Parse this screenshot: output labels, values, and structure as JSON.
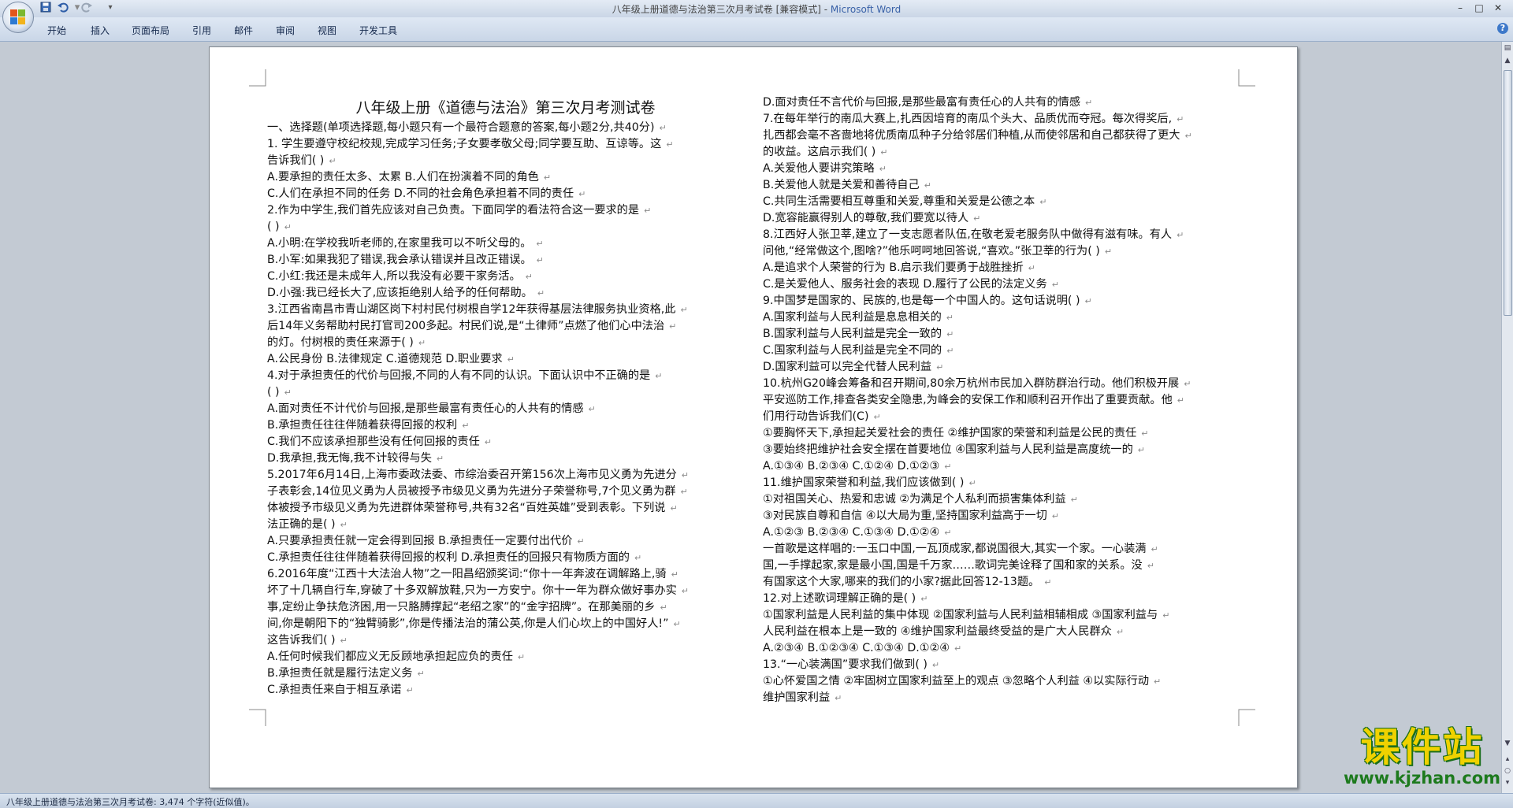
{
  "window": {
    "title_doc": "八年级上册道德与法治第三次月考试卷 [兼容模式] - ",
    "title_app": "Microsoft Word",
    "minimize": "–",
    "maximize": "□",
    "close": "✕"
  },
  "qat": {
    "save_icon": "floppy-disk-icon",
    "undo_icon": "undo-icon",
    "redo_icon": "redo-icon",
    "customize_icon": "dropdown-icon"
  },
  "ribbon": {
    "tabs": [
      {
        "label": "开始"
      },
      {
        "label": "插入"
      },
      {
        "label": "页面布局"
      },
      {
        "label": "引用"
      },
      {
        "label": "邮件"
      },
      {
        "label": "审阅"
      },
      {
        "label": "视图"
      },
      {
        "label": "开发工具"
      }
    ],
    "help": "?"
  },
  "document": {
    "title": "八年级上册《道德与法治》第三次月考测试卷",
    "left_lines": [
      "一、选择题(单项选择题,每小题只有一个最符合题意的答案,每小题2分,共40分)",
      "1.  学生要遵守校纪校规,完成学习任务;子女要孝敬父母;同学要互助、互谅等。这",
      "告诉我们(      )",
      "A.要承担的责任太多、太累            B.人们在扮演着不同的角色",
      "C.人们在承担不同的任务              D.不同的社会角色承担着不同的责任",
      "2.作为中学生,我们首先应该对自己负责。下面同学的看法符合这一要求的是",
      "(      )",
      "A.小明:在学校我听老师的,在家里我可以不听父母的。",
      "B.小军:如果我犯了错误,我会承认错误并且改正错误。",
      "C.小红:我还是未成年人,所以我没有必要干家务活。",
      "D.小强:我已经长大了,应该拒绝别人给予的任何帮助。",
      "3.江西省南昌市青山湖区岗下村村民付树根自学12年获得基层法律服务执业资格,此",
      "后14年义务帮助村民打官司200多起。村民们说,是“土律师”点燃了他们心中法治",
      "的灯。付树根的责任来源于(      )",
      "A.公民身份           B.法律规定          C.道德规范           D.职业要求",
      "4.对于承担责任的代价与回报,不同的人有不同的认识。下面认识中不正确的是",
      "(      )",
      "A.面对责任不计代价与回报,是那些最富有责任心的人共有的情感",
      "B.承担责任往往伴随着获得回报的权利",
      "C.我们不应该承担那些没有任何回报的责任",
      "D.我承担,我无悔,我不计较得与失",
      "5.2017年6月14日,上海市委政法委、市综治委召开第156次上海市见义勇为先进分",
      "子表彰会,14位见义勇为人员被授予市级见义勇为先进分子荣誉称号,7个见义勇为群",
      "体被授予市级见义勇为先进群体荣誉称号,共有32名“百姓英雄”受到表彰。下列说",
      "法正确的是(      )",
      "A.只要承担责任就一定会得到回报          B.承担责任一定要付出代价",
      "C.承担责任往往伴随着获得回报的权利      D.承担责任的回报只有物质方面的",
      "6.2016年度“江西十大法治人物”之一阳昌绍颁奖词:“你十一年奔波在调解路上,骑",
      "坏了十几辆自行车,穿破了十多双解放鞋,只为一方安宁。你十一年为群众做好事办实",
      "事,定纷止争扶危济困,用一只胳膊撑起“老绍之家”的“金字招牌”。在那美丽的乡",
      "间,你是朝阳下的“独臂骑影”,你是传播法治的蒲公英,你是人们心坎上的中国好人!”",
      "这告诉我们(      )",
      "A.任何时候我们都应义无反顾地承担起应负的责任",
      "B.承担责任就是履行法定义务",
      "C.承担责任来自于相互承诺"
    ],
    "right_lines": [
      "D.面对责任不言代价与回报,是那些最富有责任心的人共有的情感",
      "7.在每年举行的南瓜大赛上,扎西因培育的南瓜个头大、品质优而夺冠。每次得奖后,",
      "扎西都会毫不吝啬地将优质南瓜种子分给邻居们种植,从而使邻居和自己都获得了更大",
      "的收益。这启示我们(      )",
      "A.关爱他人要讲究策略",
      "B.关爱他人就是关爱和善待自己",
      "C.共同生活需要相互尊重和关爱,尊重和关爱是公德之本",
      "D.宽容能赢得别人的尊敬,我们要宽以待人",
      "8.江西好人张卫莘,建立了一支志愿者队伍,在敬老爱老服务队中做得有滋有味。有人",
      "问他,“经常做这个,图啥?”他乐呵呵地回答说,“喜欢。”张卫莘的行为(      )",
      "A.是追求个人荣誉的行为                   B.启示我们要勇于战胜挫折",
      "C.是关爱他人、服务社会的表现             D.履行了公民的法定义务",
      "9.中国梦是国家的、民族的,也是每一个中国人的。这句话说明(      )",
      "A.国家利益与人民利益是息息相关的",
      "B.国家利益与人民利益是完全一致的",
      "C.国家利益与人民利益是完全不同的",
      "D.国家利益可以完全代替人民利益",
      "10.杭州G20峰会筹备和召开期间,80余万杭州市民加入群防群治行动。他们积极开展",
      "平安巡防工作,排查各类安全隐患,为峰会的安保工作和顺利召开作出了重要贡献。他",
      "们用行动告诉我们(C)",
      "①要胸怀天下,承担起关爱社会的责任  ②维护国家的荣誉和利益是公民的责任",
      "③要始终把维护社会安全摆在首要地位  ④国家利益与人民利益是高度统一的",
      "A.①③④     B.②③④     C.①②④     D.①②③",
      "11.维护国家荣誉和利益,我们应该做到(      )",
      "①对祖国关心、热爱和忠诚 ②为满足个人私利而损害集体利益",
      "③对民族自尊和自信   ④以大局为重,坚持国家利益高于一切",
      "A.①②③     B.②③④     C.①③④     D.①②④",
      "一首歌是这样唱的:一玉口中国,一瓦顶成家,都说国很大,其实一个家。一心装满",
      "国,一手撑起家,家是最小国,国是千万家……歌词完美诠释了国和家的关系。没",
      "有国家这个大家,哪来的我们的小家?据此回答12-13题。",
      "12.对上述歌词理解正确的是(      )",
      "①国家利益是人民利益的集中体现   ②国家利益与人民利益相辅相成  ③国家利益与",
      "人民利益在根本上是一致的 ④维护国家利益最终受益的是广大人民群众",
      "A.②③④   B.①②③④   C.①③④   D.①②④",
      "13.“一心装满国”要求我们做到(      )",
      "①心怀爱国之情   ②牢固树立国家利益至上的观点   ③忽略个人利益   ④以实际行动",
      "维护国家利益"
    ],
    "paragraph_mark": "↵"
  },
  "statusbar": {
    "text": "八年级上册道德与法治第三次月考试卷: 3,474 个字符(近似值)。"
  },
  "watermark": {
    "main": "课件站",
    "url": "www.kjzhan.com"
  },
  "colors": {
    "title_accent": "#3a62a8",
    "watermark_yellow": "#f0d200",
    "watermark_green": "#1d7a1d"
  }
}
